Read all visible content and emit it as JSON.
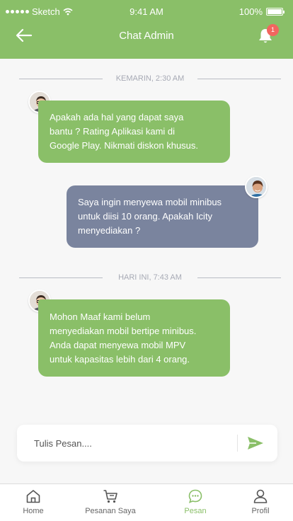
{
  "status": {
    "carrier": "Sketch",
    "time": "9:41 AM",
    "battery": "100%"
  },
  "header": {
    "title": "Chat Admin",
    "notification_count": "1"
  },
  "dividers": [
    {
      "label": "KEMARIN, 2:30 AM"
    },
    {
      "label": "HARI INI, 7:43 AM"
    }
  ],
  "messages": [
    {
      "sender": "admin",
      "lines": [
        "Apakah ada hal yang dapat saya",
        "bantu ? Rating Aplikasi kami di",
        "Google Play. Nikmati diskon khusus."
      ]
    },
    {
      "sender": "user",
      "lines": [
        "Saya ingin menyewa mobil minibus",
        "untuk diisi 10 orang. Apakah Icity",
        "menyediakan ?"
      ]
    },
    {
      "sender": "admin",
      "lines": [
        "Mohon Maaf kami belum",
        "menyediakan mobil bertipe minibus.",
        "Anda dapat menyewa mobil MPV",
        "untuk kapasitas lebih dari 4 orang."
      ]
    }
  ],
  "compose": {
    "placeholder": "Tulis Pesan...."
  },
  "tabs": [
    {
      "label": "Home",
      "icon": "home-icon"
    },
    {
      "label": "Pesanan Saya",
      "icon": "cart-icon"
    },
    {
      "label": "Pesan",
      "icon": "chat-icon",
      "active": true
    },
    {
      "label": "Profil",
      "icon": "user-icon"
    }
  ],
  "colors": {
    "primary": "#8abf68",
    "user_bubble": "#7a849e",
    "badge": "#f2665f"
  }
}
